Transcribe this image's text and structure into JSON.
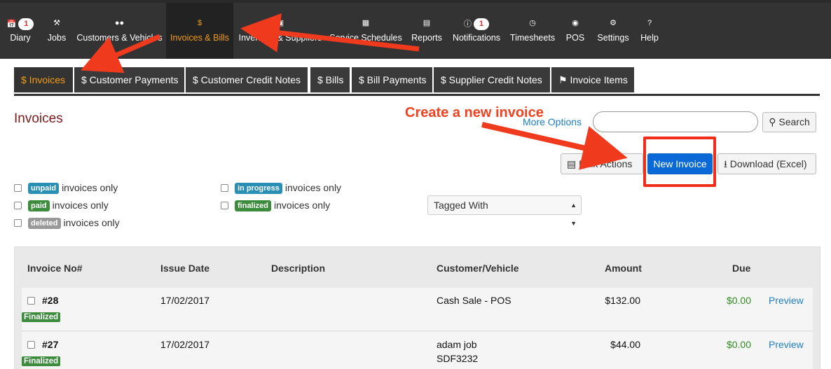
{
  "nav": {
    "items": [
      {
        "label": "Diary",
        "icon": "calendar-icon",
        "badge": "1"
      },
      {
        "label": "Jobs",
        "icon": "wrench-icon"
      },
      {
        "label": "Customers & Vehicles",
        "icon": "users-icon"
      },
      {
        "label": "Invoices & Bills",
        "icon": "dollar-icon",
        "active": true
      },
      {
        "label": "Inventory & Suppliers",
        "icon": "box-icon"
      },
      {
        "label": "Service Schedules",
        "icon": "calendar-icon"
      },
      {
        "label": "Reports",
        "icon": "bar-chart-icon"
      },
      {
        "label": "Notifications",
        "icon": "info-icon",
        "badge": "1"
      },
      {
        "label": "Timesheets",
        "icon": "clock-icon"
      },
      {
        "label": "POS",
        "icon": "cash-icon"
      },
      {
        "label": "Settings",
        "icon": "gears-icon"
      },
      {
        "label": "Help",
        "icon": "question-icon"
      }
    ]
  },
  "subtabs": [
    {
      "label": "$ Invoices",
      "active": true
    },
    {
      "label": "$ Customer Payments"
    },
    {
      "label": "$ Customer Credit Notes"
    },
    {
      "label": "$ Bills"
    },
    {
      "label": "$ Bill Payments"
    },
    {
      "label": "$ Supplier Credit Notes"
    },
    {
      "label": "Invoice Items",
      "icon": "tag-icon"
    }
  ],
  "page": {
    "title": "Invoices",
    "more_options": "More Options",
    "search_button": "Search",
    "bulk_button": "Bulk Actions",
    "new_button": "New Invoice",
    "download_button": "Download (Excel)"
  },
  "filters": {
    "unpaid_pill": "unpaid",
    "paid_pill": "paid",
    "deleted_pill": "deleted",
    "in_progress_pill": "in progress",
    "finalized_pill": "finalized",
    "suffix": "invoices only",
    "tagged_with": "Tagged With"
  },
  "colors": {
    "unpaid": "#2a8fb5",
    "paid": "#3d8b3d",
    "deleted": "#999999",
    "in_progress": "#2a8fb5",
    "finalized": "#3d8b3d",
    "accent": "#f39c12",
    "primary": "#0a69d6",
    "annotation": "#f02d19"
  },
  "table": {
    "headers": {
      "invoice_no": "Invoice No#",
      "issue_date": "Issue Date",
      "description": "Description",
      "customer": "Customer/Vehicle",
      "amount": "Amount",
      "due": "Due"
    },
    "rows": [
      {
        "no": "#28",
        "status": "Finalized",
        "date": "17/02/2017",
        "description": "",
        "customer": "Cash Sale - POS",
        "vehicle": "",
        "amount": "$132.00",
        "due": "$0.00",
        "action": "Preview"
      },
      {
        "no": "#27",
        "status": "Finalized",
        "date": "17/02/2017",
        "description": "",
        "customer": "adam job",
        "vehicle": "SDF3232",
        "amount": "$44.00",
        "due": "$0.00",
        "action": "Preview"
      }
    ]
  },
  "annotation": {
    "text": "Create a new invoice"
  }
}
